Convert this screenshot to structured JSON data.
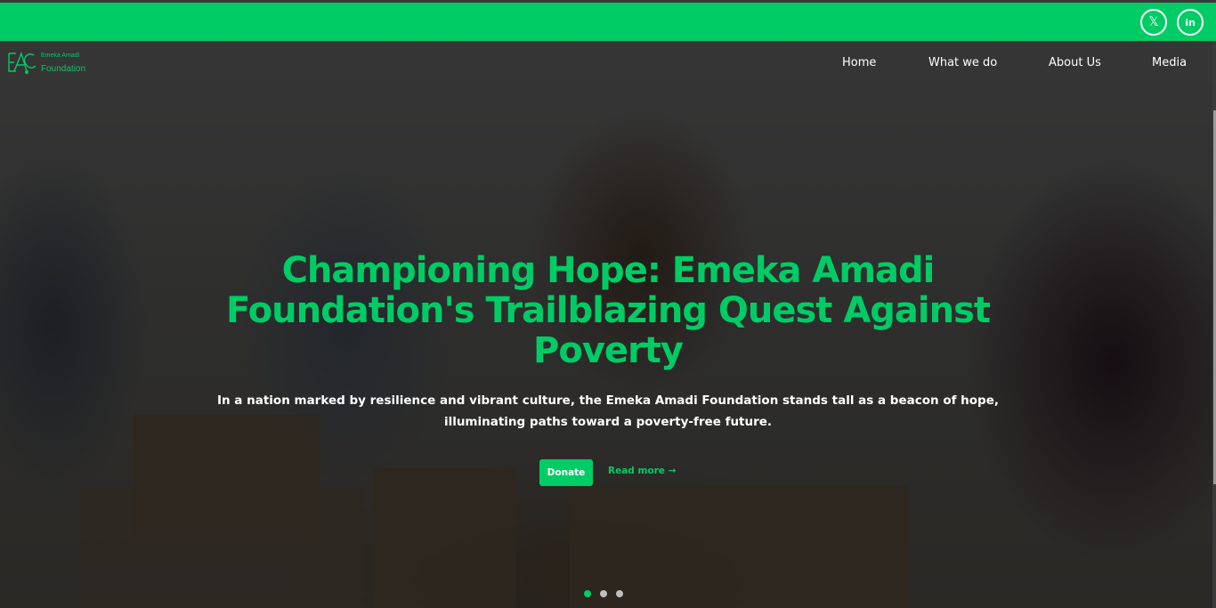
{
  "social": {
    "x_glyph": "𝕏",
    "linkedin_glyph": "in"
  },
  "logo": {
    "small_text": "Emeka Amadi",
    "big_text": "Foundation"
  },
  "nav": {
    "home": "Home",
    "what_we_do": "What we do",
    "about": "About Us",
    "media": "Media"
  },
  "hero": {
    "headline": "Championing Hope: Emeka Amadi Foundation's Trailblazing Quest Against Poverty",
    "subtitle": "In a nation marked by resilience and vibrant culture, the Emeka Amadi Foundation stands tall as a beacon of hope, illuminating paths toward a poverty-free future.",
    "donate_label": "Donate",
    "read_more_label": "Read more →",
    "slides": 3,
    "active_slide": 1
  },
  "colors": {
    "brand_green": "#00cc66",
    "overlay": "rgba(0,0,0,0.62)"
  },
  "icons": [
    "x-icon",
    "linkedin-icon",
    "logo-mark-icon"
  ]
}
